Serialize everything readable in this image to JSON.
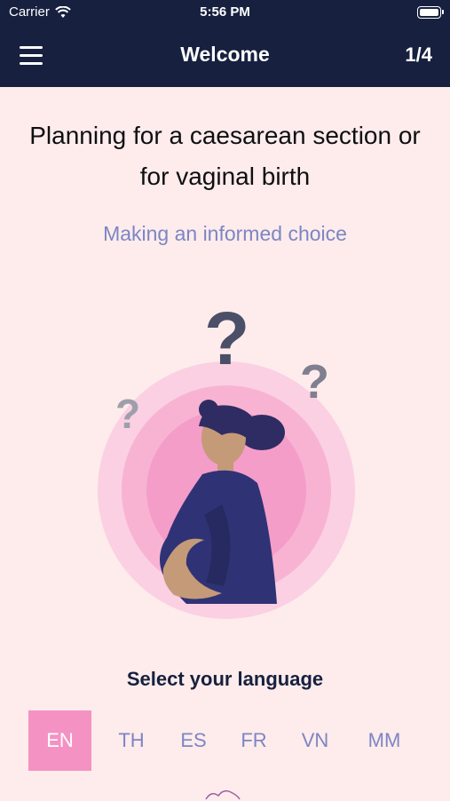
{
  "status_bar": {
    "carrier": "Carrier",
    "time": "5:56 PM"
  },
  "nav": {
    "title": "Welcome",
    "page_indicator": "1/4"
  },
  "content": {
    "heading_line1": "Planning for a caesarean section or",
    "heading_line2": "for vaginal birth",
    "subheading": "Making an informed choice"
  },
  "language": {
    "label": "Select your language",
    "options": [
      "EN",
      "TH",
      "ES",
      "FR",
      "VN",
      "MM"
    ],
    "selected": "EN"
  },
  "colors": {
    "nav_bg": "#17203f",
    "page_bg": "#fdeceb",
    "accent_pink": "#f592c4",
    "subtitle_blue": "#7d85c4"
  }
}
